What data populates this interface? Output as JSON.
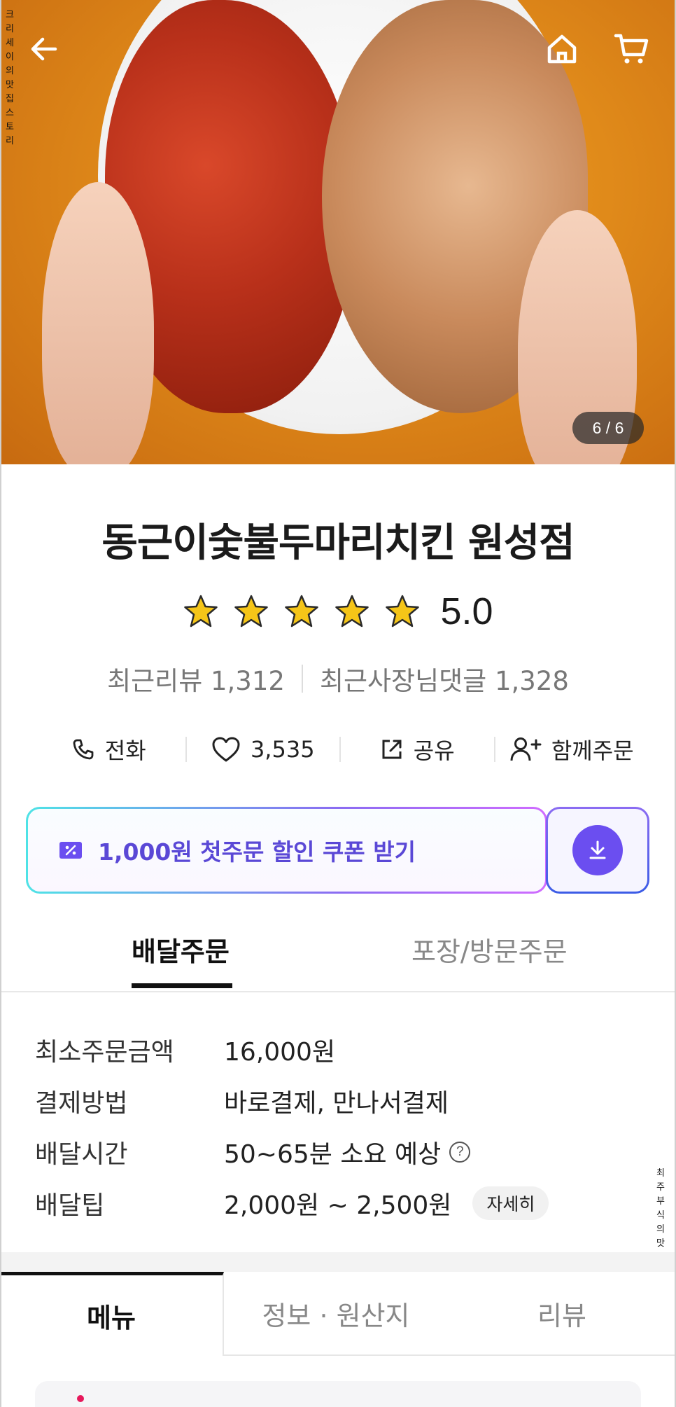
{
  "hero": {
    "watermark_vertical": "크리세이의맛집스토리",
    "image_counter": "6 / 6",
    "icons": [
      "back-arrow-icon",
      "home-icon",
      "cart-icon"
    ]
  },
  "side_watermark": "최주부식의맛있는맛집탐방기",
  "store": {
    "name": "동근이숯불두마리치킨 원성점",
    "rating": "5.0",
    "star_count": 5,
    "recent_reviews": "최근리뷰 1,312",
    "recent_owner_replies": "최근사장님댓글 1,328"
  },
  "actions": {
    "call": "전화",
    "likes": "3,535",
    "share": "공유",
    "group_order": "함께주문"
  },
  "coupon": {
    "text": "1,000원 첫주문 할인 쿠폰 받기",
    "colors": {
      "accent": "#6b4ef0",
      "text": "#5a48d6"
    }
  },
  "order_tabs": {
    "delivery": "배달주문",
    "pickup": "포장/방문주문"
  },
  "info": {
    "min_order_label": "최소주문금액",
    "min_order_value": "16,000원",
    "payment_label": "결제방법",
    "payment_value": "바로결제, 만나서결제",
    "delivery_time_label": "배달시간",
    "delivery_time_value": "50~65분 소요 예상",
    "tip_label": "배달팁",
    "tip_value": "2,000원 ~ 2,500원",
    "detail_button": "자세히"
  },
  "bottom_tabs": {
    "menu": "메뉴",
    "info_origin": "정보 · 원산지",
    "reviews": "리뷰"
  }
}
